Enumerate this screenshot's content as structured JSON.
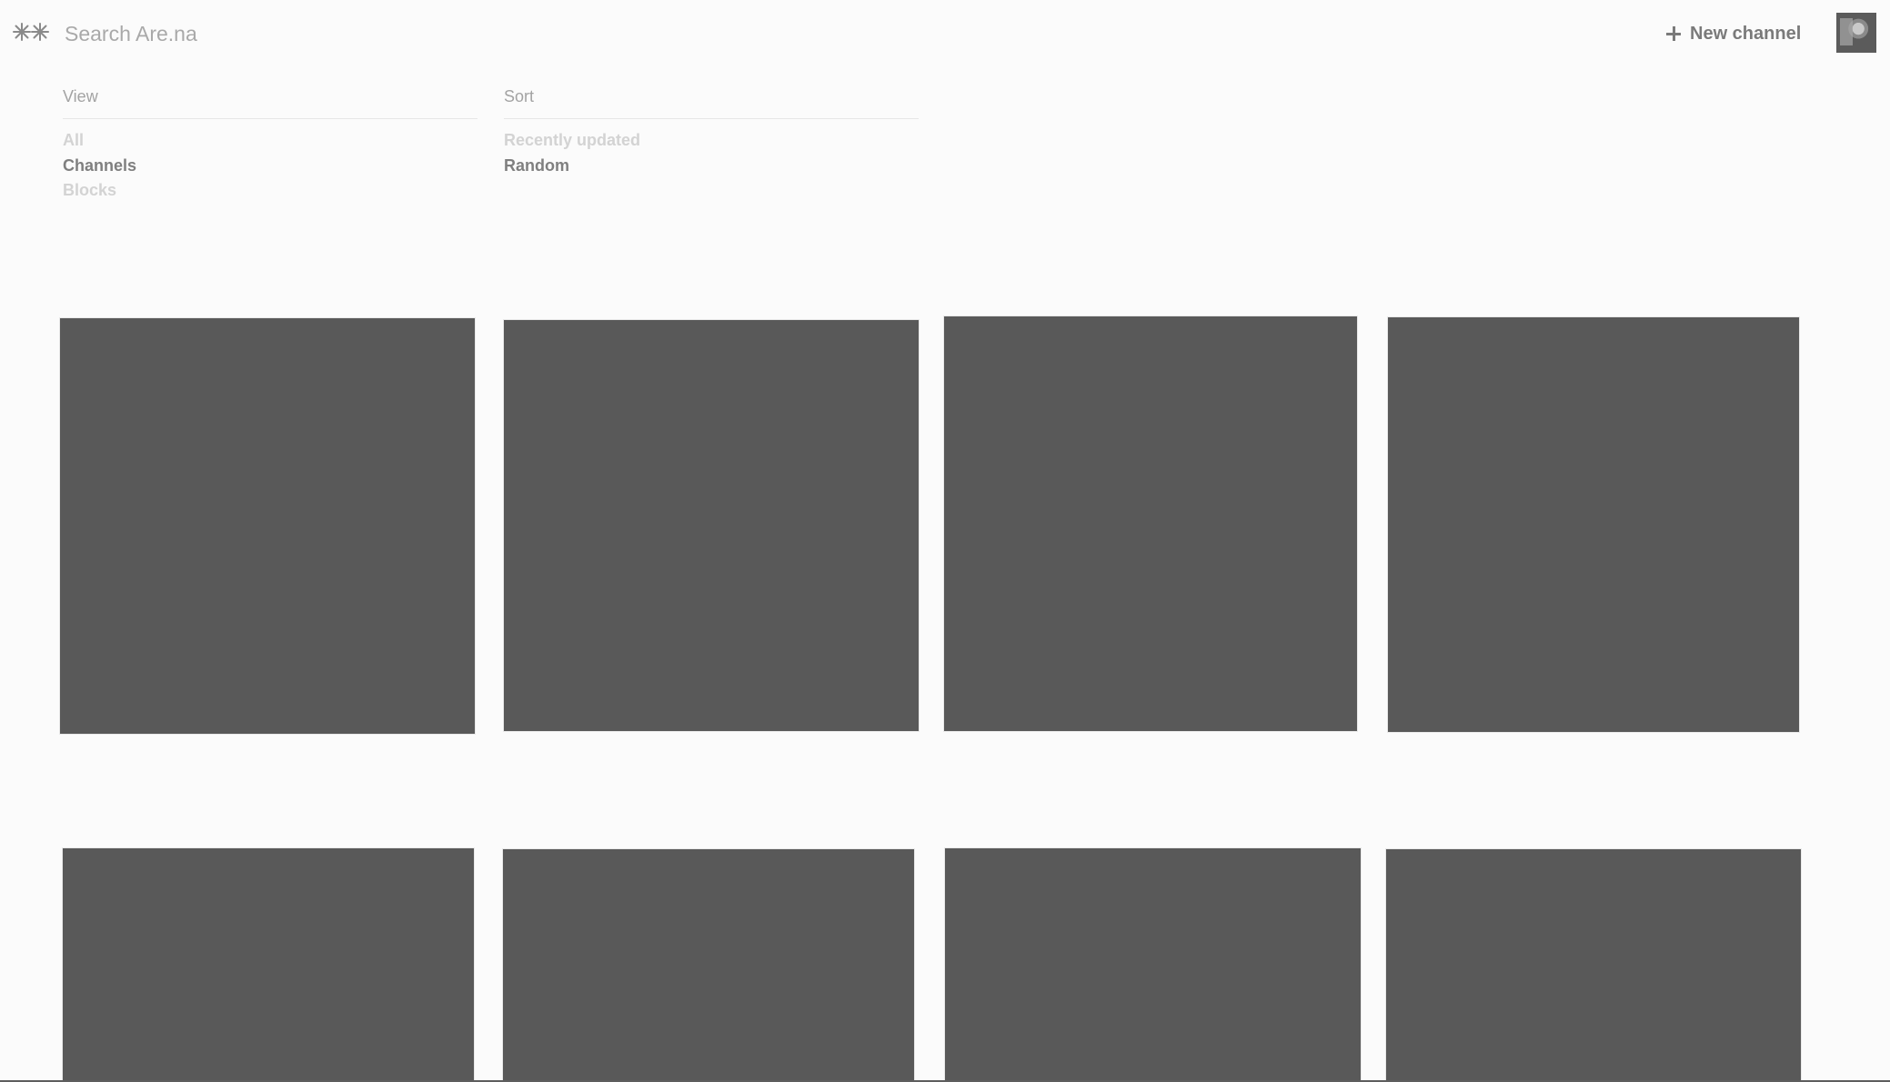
{
  "header": {
    "logo_icon": "arena-logo-icon",
    "search_placeholder": "Search Are.na",
    "new_channel_label": "New channel",
    "new_channel_icon": "plus-icon",
    "avatar_icon": "user-avatar"
  },
  "filters": {
    "view": {
      "heading": "View",
      "options": [
        "All",
        "Channels",
        "Blocks"
      ],
      "selected": "Channels"
    },
    "sort": {
      "heading": "Sort",
      "options": [
        "Recently updated",
        "Random"
      ],
      "selected": "Random"
    }
  },
  "grid": {
    "card_color": "#595959",
    "card_count": 8
  }
}
